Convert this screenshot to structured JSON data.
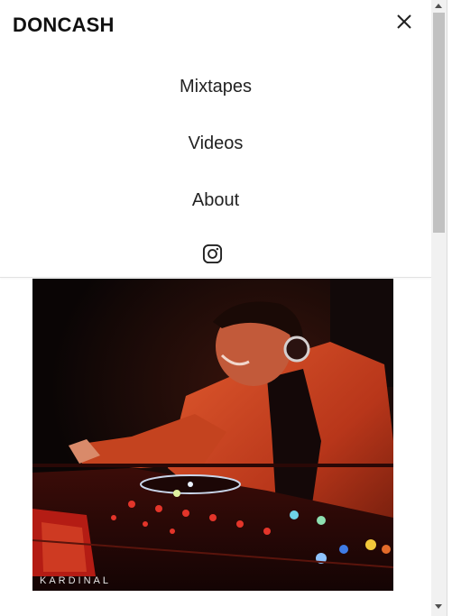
{
  "header": {
    "brand": "DONCASH",
    "close_icon": "close-icon"
  },
  "nav": {
    "items": [
      {
        "label": "Mixtapes"
      },
      {
        "label": "Videos"
      },
      {
        "label": "About"
      }
    ],
    "social_icon": "instagram-icon"
  },
  "photo": {
    "caption": "KARDINAL"
  },
  "colors": {
    "accent_warm": "#d2451e",
    "background": "#ffffff",
    "text": "#222222"
  }
}
